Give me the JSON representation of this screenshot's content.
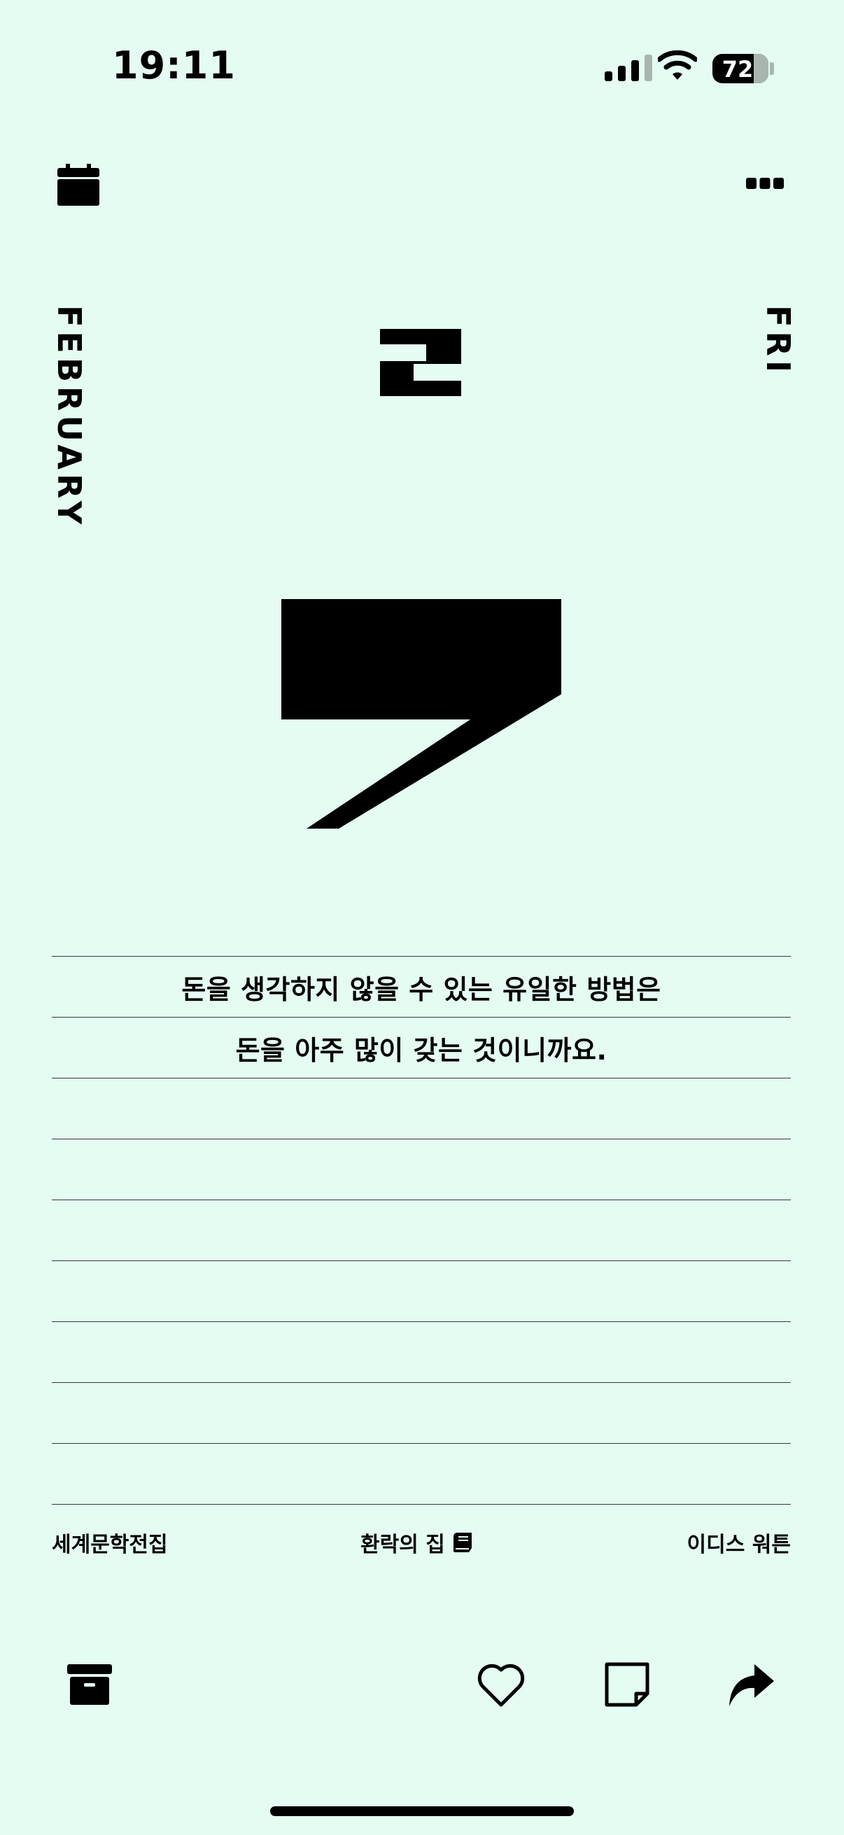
{
  "status_bar": {
    "time": "19:11",
    "battery": "72"
  },
  "date": {
    "month": "FEBRUARY",
    "weekday": "FRI",
    "day_digits": [
      "2",
      "7"
    ]
  },
  "quote": {
    "lines": [
      "돈을 생각하지 않을 수 있는 유일한 방법은",
      "돈을 아주 많이 갖는 것이니까요.",
      "",
      "",
      "",
      "",
      "",
      "",
      "",
      ""
    ]
  },
  "source": {
    "series": "세계문학전집",
    "book_title": "환락의 집",
    "author": "이디스 워튼"
  },
  "icons": {
    "calendar": "calendar-icon",
    "more": "more-icon",
    "book": "book-icon",
    "archive": "archive-box-icon",
    "heart": "heart-icon",
    "note": "note-icon",
    "share": "share-arrow-icon"
  },
  "colors": {
    "background": "#e4fcf1",
    "ink": "#000000",
    "muted": "#a9b6af"
  }
}
